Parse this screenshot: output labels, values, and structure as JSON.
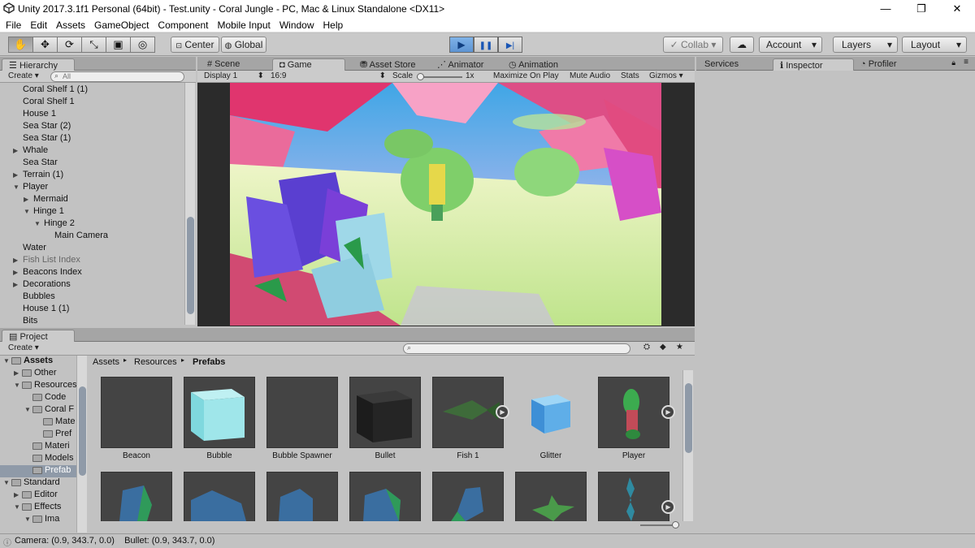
{
  "window": {
    "title": "Unity 2017.3.1f1 Personal (64bit) - Test.unity - Coral Jungle - PC, Mac & Linux Standalone <DX11>"
  },
  "window_controls": {
    "minimize": "—",
    "maximize": "❐",
    "close": "✕"
  },
  "menu": [
    "File",
    "Edit",
    "Assets",
    "GameObject",
    "Component",
    "Mobile Input",
    "Window",
    "Help"
  ],
  "toolbar": {
    "tool_icons": [
      "hand-icon",
      "move-icon",
      "rotate-icon",
      "scale-icon",
      "rect-icon",
      "transform-icon"
    ],
    "tool_glyphs": [
      "✋",
      "✥",
      "⟳",
      "⤡",
      "▣",
      "◎"
    ],
    "pivot": "Center",
    "space": "Global",
    "play": "▶",
    "pause": "❚❚",
    "step": "▶|",
    "collab": "Collab",
    "account": "Account",
    "layers": "Layers",
    "layout": "Layout"
  },
  "hierarchy": {
    "tab": "Hierarchy",
    "create": "Create",
    "search_placeholder": "All",
    "items": [
      {
        "label": "Coral Shelf 1 (1)",
        "indent": 0,
        "arrow": "",
        "dim": false
      },
      {
        "label": "Coral Shelf 1",
        "indent": 0,
        "arrow": "",
        "dim": false
      },
      {
        "label": "House 1",
        "indent": 0,
        "arrow": "",
        "dim": false
      },
      {
        "label": "Sea Star (2)",
        "indent": 0,
        "arrow": "",
        "dim": false
      },
      {
        "label": "Sea Star (1)",
        "indent": 0,
        "arrow": "",
        "dim": false
      },
      {
        "label": "Whale",
        "indent": 0,
        "arrow": "▶",
        "dim": false
      },
      {
        "label": "Sea Star",
        "indent": 0,
        "arrow": "",
        "dim": false
      },
      {
        "label": "Terrain (1)",
        "indent": 0,
        "arrow": "▶",
        "dim": false
      },
      {
        "label": "Player",
        "indent": 0,
        "arrow": "▼",
        "dim": false
      },
      {
        "label": "Mermaid",
        "indent": 1,
        "arrow": "▶",
        "dim": false
      },
      {
        "label": "Hinge 1",
        "indent": 1,
        "arrow": "▼",
        "dim": false
      },
      {
        "label": "Hinge 2",
        "indent": 2,
        "arrow": "▼",
        "dim": false
      },
      {
        "label": "Main Camera",
        "indent": 3,
        "arrow": "",
        "dim": false
      },
      {
        "label": "Water",
        "indent": 0,
        "arrow": "",
        "dim": false
      },
      {
        "label": "Fish List Index",
        "indent": 0,
        "arrow": "▶",
        "dim": true
      },
      {
        "label": "Beacons Index",
        "indent": 0,
        "arrow": "▶",
        "dim": false
      },
      {
        "label": "Decorations",
        "indent": 0,
        "arrow": "▶",
        "dim": false
      },
      {
        "label": "Bubbles",
        "indent": 0,
        "arrow": "",
        "dim": false
      },
      {
        "label": "House 1 (1)",
        "indent": 0,
        "arrow": "",
        "dim": false
      },
      {
        "label": "Bits",
        "indent": 0,
        "arrow": "",
        "dim": false
      }
    ]
  },
  "center_tabs": [
    {
      "label": "# Scene",
      "selected": false
    },
    {
      "label": "Game",
      "selected": true
    },
    {
      "label": "Asset Store",
      "selected": false
    },
    {
      "label": "Animator",
      "selected": false
    },
    {
      "label": "Animation",
      "selected": false
    }
  ],
  "game_bar": {
    "display": "Display 1",
    "aspect": "16:9",
    "scale_label": "Scale",
    "scale_value": "1x",
    "maximize": "Maximize On Play",
    "mute": "Mute Audio",
    "stats": "Stats",
    "gizmos": "Gizmos"
  },
  "right_tabs": [
    {
      "label": "Services",
      "selected": false
    },
    {
      "label": "Inspector",
      "selected": true
    },
    {
      "label": "Profiler",
      "selected": false
    }
  ],
  "project": {
    "tab": "Project",
    "create": "Create",
    "breadcrumb": [
      "Assets",
      "Resources",
      "Prefabs"
    ],
    "tree": [
      {
        "label": "Assets",
        "indent": 0,
        "arrow": "▼",
        "bold": true,
        "sel": false
      },
      {
        "label": "Other",
        "indent": 1,
        "arrow": "▶",
        "bold": false,
        "sel": false
      },
      {
        "label": "Resources",
        "indent": 1,
        "arrow": "▼",
        "bold": false,
        "sel": false
      },
      {
        "label": "Code",
        "indent": 2,
        "arrow": "",
        "bold": false,
        "sel": false
      },
      {
        "label": "Coral F",
        "indent": 2,
        "arrow": "▼",
        "bold": false,
        "sel": false
      },
      {
        "label": "Mate",
        "indent": 3,
        "arrow": "",
        "bold": false,
        "sel": false
      },
      {
        "label": "Pref",
        "indent": 3,
        "arrow": "",
        "bold": false,
        "sel": false
      },
      {
        "label": "Materi",
        "indent": 2,
        "arrow": "",
        "bold": false,
        "sel": false
      },
      {
        "label": "Models",
        "indent": 2,
        "arrow": "",
        "bold": false,
        "sel": false
      },
      {
        "label": "Prefab",
        "indent": 2,
        "arrow": "",
        "bold": false,
        "sel": true
      },
      {
        "label": "Standard",
        "indent": 0,
        "arrow": "▼",
        "bold": false,
        "sel": false
      },
      {
        "label": "Editor",
        "indent": 1,
        "arrow": "▶",
        "bold": false,
        "sel": false
      },
      {
        "label": "Effects",
        "indent": 1,
        "arrow": "▼",
        "bold": false,
        "sel": false
      },
      {
        "label": "Ima",
        "indent": 2,
        "arrow": "▼",
        "bold": false,
        "sel": false
      }
    ],
    "assets_row1": [
      "Beacon",
      "Bubble",
      "Bubble Spawner",
      "Bullet",
      "Fish 1",
      "Glitter",
      "Player"
    ]
  },
  "status": {
    "text": "Camera: (0.9, 343.7, 0.0)    Bullet: (0.9, 343.7, 0.0)"
  },
  "colors": {
    "play_active": "#5d94d3",
    "panel": "#c2c2c2",
    "tab_bar": "#a5a5a5",
    "selection": "#8f9aa8"
  }
}
